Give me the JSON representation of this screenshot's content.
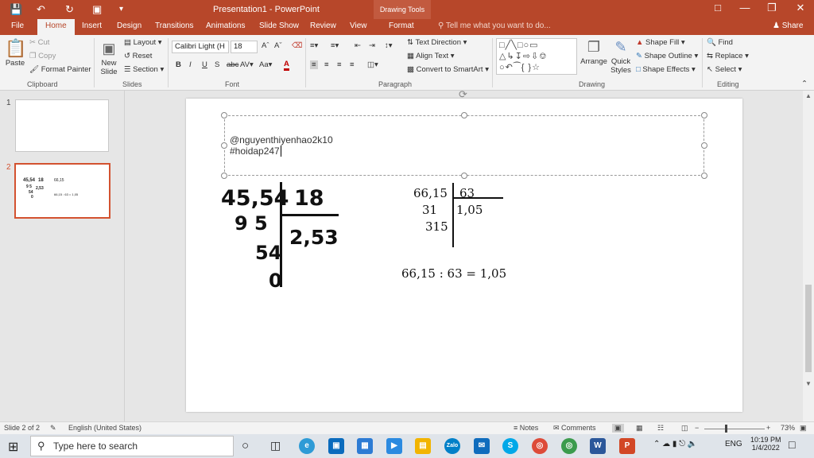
{
  "app": {
    "title": "Presentation1 - PowerPoint",
    "drawing_tools": "Drawing Tools"
  },
  "tabs": [
    "File",
    "Home",
    "Insert",
    "Design",
    "Transitions",
    "Animations",
    "Slide Show",
    "Review",
    "View",
    "Format"
  ],
  "tell_me": "Tell me what you want to do...",
  "share": "Share",
  "ribbon": {
    "clipboard": {
      "paste": "Paste",
      "cut": "Cut",
      "copy": "Copy",
      "format_painter": "Format Painter",
      "label": "Clipboard"
    },
    "slides": {
      "new_slide": "New",
      "new_slide2": "Slide",
      "layout": "Layout",
      "reset": "Reset",
      "section": "Section",
      "label": "Slides"
    },
    "font": {
      "name": "Calibri Light (H",
      "size": "18",
      "label": "Font"
    },
    "paragraph": {
      "text_direction": "Text Direction",
      "align_text": "Align Text",
      "convert_smartart": "Convert to SmartArt",
      "label": "Paragraph"
    },
    "drawing": {
      "arrange": "Arrange",
      "quick": "Quick",
      "styles": "Styles",
      "shape_fill": "Shape Fill",
      "shape_outline": "Shape Outline",
      "shape_effects": "Shape Effects",
      "label": "Drawing"
    },
    "editing": {
      "find": "Find",
      "replace": "Replace",
      "select": "Select",
      "label": "Editing"
    }
  },
  "thumbnails": [
    "1",
    "2"
  ],
  "slide": {
    "textbox_line1": "@nguyenthiyenhao2k10",
    "textbox_line2": "#hoidap247",
    "hw_dividend": "45,54",
    "hw_divisor": "18",
    "hw_rem1": "9 5",
    "hw_quotient": "2,53",
    "hw_rem2": "54",
    "hw_rem3": "0",
    "ty_dividend": "66,15",
    "ty_divisor": "63",
    "ty_rem1": "31",
    "ty_quotient": "1,05",
    "ty_rem2": "315",
    "equation": "66,15 : 63 = 1,05"
  },
  "status": {
    "slide_info": "Slide 2 of 2",
    "language": "English (United States)",
    "notes": "Notes",
    "comments": "Comments",
    "zoom": "73%"
  },
  "taskbar": {
    "search_placeholder": "Type here to search",
    "lang": "ENG",
    "time": "10:19 PM",
    "date": "1/4/2022"
  }
}
